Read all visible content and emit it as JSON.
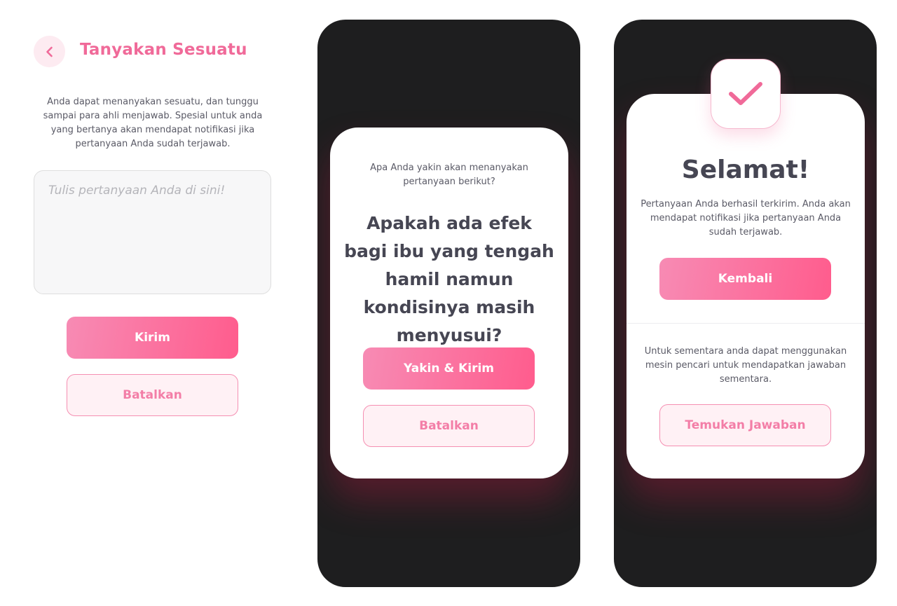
{
  "screen_ask": {
    "title": "Tanyakan Sesuatu",
    "back_icon": "chevron-left-icon",
    "description": "Anda dapat menanyakan sesuatu, dan tunggu sampai para ahli menjawab. Spesial untuk anda yang bertanya akan mendapat notifikasi jika pertanyaan Anda sudah terjawab.",
    "question_input": {
      "value": "",
      "placeholder": "Tulis pertanyaan Anda di sini!"
    },
    "submit_label": "Kirim",
    "cancel_label": "Batalkan"
  },
  "screen_confirm": {
    "prompt": "Apa Anda yakin akan menanyakan pertanyaan berikut?",
    "question": "Apakah ada efek bagi ibu yang tengah hamil namun kondisinya masih menyusui?",
    "confirm_label": "Yakin & Kirim",
    "cancel_label": "Batalkan"
  },
  "screen_success": {
    "badge_icon": "checkmark-icon",
    "title": "Selamat!",
    "message": "Pertanyaan Anda berhasil terkirim. Anda akan mendapat notifikasi jika pertanyaan Anda sudah terjawab.",
    "back_label": "Kembali",
    "secondary_message": "Untuk sementara anda dapat menggunakan mesin pencari untuk mendapatkan jawaban sementara.",
    "find_answer_label": "Temukan Jawaban"
  },
  "colors": {
    "accent": "#f06a99",
    "gradient_start": "#f78bb4",
    "gradient_end": "#ff5c8d",
    "secondary_bg": "#fff1f5",
    "phone_bg": "#1e1e1f",
    "text_dark": "#464653"
  }
}
